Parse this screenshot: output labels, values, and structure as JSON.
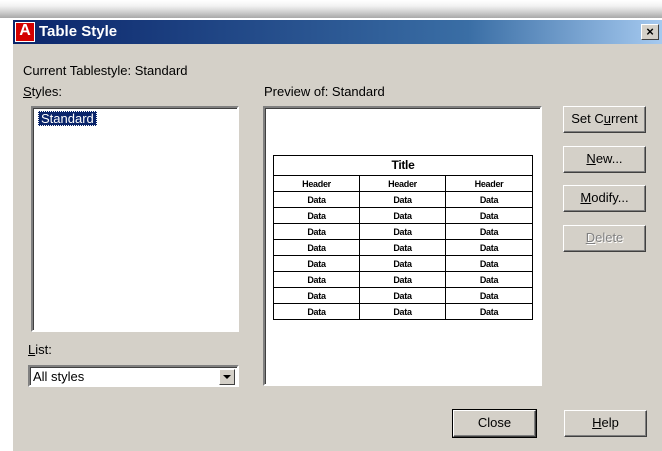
{
  "window": {
    "title": "Table Style",
    "close_label": "×"
  },
  "current_tablestyle": {
    "label": "Current Tablestyle: Standard"
  },
  "styles": {
    "label": "Styles:",
    "items": [
      "Standard"
    ],
    "selected": "Standard"
  },
  "preview": {
    "label": "Preview of: Standard",
    "table": {
      "title": "Title",
      "headers": [
        "Header",
        "Header",
        "Header"
      ],
      "rows": [
        [
          "Data",
          "Data",
          "Data"
        ],
        [
          "Data",
          "Data",
          "Data"
        ],
        [
          "Data",
          "Data",
          "Data"
        ],
        [
          "Data",
          "Data",
          "Data"
        ],
        [
          "Data",
          "Data",
          "Data"
        ],
        [
          "Data",
          "Data",
          "Data"
        ],
        [
          "Data",
          "Data",
          "Data"
        ],
        [
          "Data",
          "Data",
          "Data"
        ]
      ]
    }
  },
  "list": {
    "label": "List:",
    "selected": "All styles"
  },
  "buttons": {
    "set_current": "Set Current",
    "new": "New...",
    "modify": "Modify...",
    "delete": "Delete",
    "close": "Close",
    "help": "Help"
  }
}
